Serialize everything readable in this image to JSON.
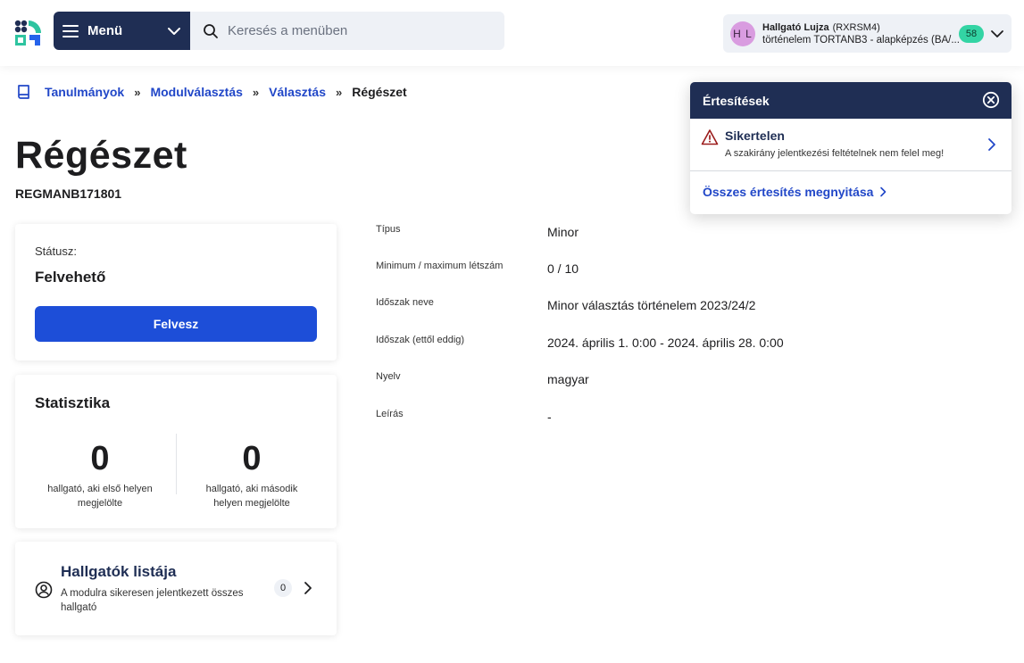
{
  "header": {
    "menu_label": "Menü",
    "search_placeholder": "Keresés a menüben",
    "user": {
      "initials": "H L",
      "name": "Hallgató Lujza",
      "code": "(RXRSM4)",
      "program": "történelem TORTANB3 - alapképzés (BA/...",
      "badge": "58"
    }
  },
  "breadcrumb": {
    "items": [
      "Tanulmányok",
      "Modulválasztás",
      "Választás"
    ],
    "separator": "»",
    "current": "Régészet"
  },
  "page": {
    "title": "Régészet",
    "code": "REGMANB171801"
  },
  "status_card": {
    "label": "Státusz:",
    "value": "Felvehető",
    "button": "Felvesz"
  },
  "stats_card": {
    "title": "Statisztika",
    "first": {
      "value": "0",
      "desc_line1": "hallgató, aki első helyen",
      "desc_line2": "megjelölte"
    },
    "second": {
      "value": "0",
      "desc_line1": "hallgató, aki második",
      "desc_line2": "helyen megjelölte"
    }
  },
  "students_card": {
    "title": "Hallgatók listája",
    "desc": "A modulra sikeresen jelentkezett összes hallgató",
    "count": "0"
  },
  "details": [
    {
      "label": "Típus",
      "value": "Minor"
    },
    {
      "label": "Minimum / maximum létszám",
      "value": "0 / 10"
    },
    {
      "label": "Időszak neve",
      "value": "Minor választás történelem 2023/24/2"
    },
    {
      "label": "Időszak (ettől eddig)",
      "value": "2024. április 1. 0:00 - 2024. április 28. 0:00"
    },
    {
      "label": "Nyelv",
      "value": "magyar"
    },
    {
      "label": "Leírás",
      "value": "-"
    }
  ],
  "notifications": {
    "title": "Értesítések",
    "item": {
      "title": "Sikertelen",
      "desc": "A szakirány jelentkezési feltételnek nem felel meg!"
    },
    "open_all": "Összes értesítés megnyitása"
  },
  "colors": {
    "navy": "#1f2e54",
    "primary": "#1d4ed8",
    "link": "#2147c8",
    "badge_green": "#33d4a4",
    "avatar": "#d99ce0",
    "warning": "#9b1c1c"
  },
  "icons": [
    "app-logo-icon",
    "hamburger-icon",
    "chevron-down-icon",
    "search-icon",
    "book-icon",
    "user-circle-icon",
    "chevron-right-icon",
    "close-circle-icon",
    "warning-icon"
  ]
}
